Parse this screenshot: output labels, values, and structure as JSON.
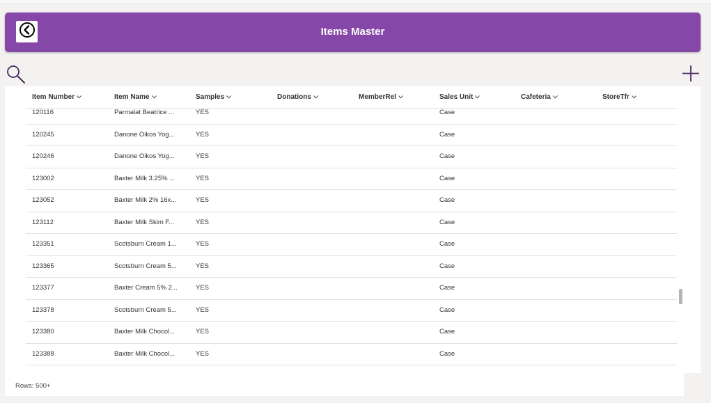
{
  "header": {
    "title": "Items Master",
    "back_icon": "back-arrow-circle-icon",
    "background_color": "#8548a8"
  },
  "toolbar": {
    "search_icon": "search-icon",
    "add_icon": "plus-icon"
  },
  "table": {
    "columns": [
      "Item Number",
      "Item Name",
      "Samples",
      "Donations",
      "MemberRel",
      "Sales Unit",
      "Cafeteria",
      "StoreTfr"
    ],
    "rows": [
      {
        "item_number": "120116",
        "item_name": "Parmalat Beatrice ...",
        "samples": "YES",
        "donations": "",
        "memberrel": "",
        "sales_unit": "Case",
        "cafeteria": "",
        "storetfr": ""
      },
      {
        "item_number": "120245",
        "item_name": "Danone Oikos Yog...",
        "samples": "YES",
        "donations": "",
        "memberrel": "",
        "sales_unit": "Case",
        "cafeteria": "",
        "storetfr": ""
      },
      {
        "item_number": "120246",
        "item_name": "Danone Oikos Yog...",
        "samples": "YES",
        "donations": "",
        "memberrel": "",
        "sales_unit": "Case",
        "cafeteria": "",
        "storetfr": ""
      },
      {
        "item_number": "123002",
        "item_name": "Baxter Milk 3.25% ...",
        "samples": "YES",
        "donations": "",
        "memberrel": "",
        "sales_unit": "Case",
        "cafeteria": "",
        "storetfr": ""
      },
      {
        "item_number": "123052",
        "item_name": "Baxter Milk 2% 16x...",
        "samples": "YES",
        "donations": "",
        "memberrel": "",
        "sales_unit": "Case",
        "cafeteria": "",
        "storetfr": ""
      },
      {
        "item_number": "123112",
        "item_name": "Baxter Milk Skim F...",
        "samples": "YES",
        "donations": "",
        "memberrel": "",
        "sales_unit": "Case",
        "cafeteria": "",
        "storetfr": ""
      },
      {
        "item_number": "123351",
        "item_name": "Scotsburn Cream 1...",
        "samples": "YES",
        "donations": "",
        "memberrel": "",
        "sales_unit": "Case",
        "cafeteria": "",
        "storetfr": ""
      },
      {
        "item_number": "123365",
        "item_name": "Scotsburn Cream 5...",
        "samples": "YES",
        "donations": "",
        "memberrel": "",
        "sales_unit": "Case",
        "cafeteria": "",
        "storetfr": ""
      },
      {
        "item_number": "123377",
        "item_name": "Baxter Cream 5% 2...",
        "samples": "YES",
        "donations": "",
        "memberrel": "",
        "sales_unit": "Case",
        "cafeteria": "",
        "storetfr": ""
      },
      {
        "item_number": "123378",
        "item_name": "Scotsburn Cream 5...",
        "samples": "YES",
        "donations": "",
        "memberrel": "",
        "sales_unit": "Case",
        "cafeteria": "",
        "storetfr": ""
      },
      {
        "item_number": "123380",
        "item_name": "Baxter Milk Chocol...",
        "samples": "YES",
        "donations": "",
        "memberrel": "",
        "sales_unit": "Case",
        "cafeteria": "",
        "storetfr": ""
      },
      {
        "item_number": "123388",
        "item_name": "Baxter Milk Chocol...",
        "samples": "YES",
        "donations": "",
        "memberrel": "",
        "sales_unit": "Case",
        "cafeteria": "",
        "storetfr": ""
      }
    ]
  },
  "footer": {
    "rows_count": "Rows: 500+"
  }
}
